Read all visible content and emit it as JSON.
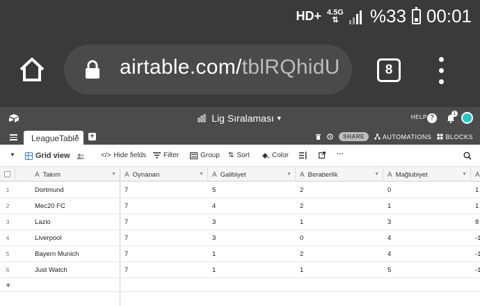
{
  "statusbar": {
    "network": "HD+",
    "network_gen": "4.5G",
    "battery": "%33",
    "time": "00:01"
  },
  "browser": {
    "url_main": "airtable.com/",
    "url_dim": "tblRQhidU",
    "tab_count": "8"
  },
  "app": {
    "base_title": "Lig Sıralaması",
    "help_label": "HELP",
    "notification_count": "1"
  },
  "tabs": {
    "active_table": "LeagueTable",
    "share_label": "SHARE",
    "automations_label": "AUTOMATIONS",
    "blocks_label": "BLOCKS"
  },
  "viewbar": {
    "view_name": "Grid view",
    "hide_fields": "Hide fields",
    "filter": "Filter",
    "group": "Group",
    "sort": "Sort",
    "color": "Color",
    "more": "···"
  },
  "grid": {
    "columns": [
      "Takım",
      "Oynanan",
      "Galibiyet",
      "Beraberlik",
      "Mağlubiyet"
    ],
    "rows": [
      {
        "n": "1",
        "takim": "Dortmund",
        "oynanan": "7",
        "galibiyet": "5",
        "beraberlik": "2",
        "maglubiyet": "0",
        "extra": "1"
      },
      {
        "n": "2",
        "takim": "Mec20 FC",
        "oynanan": "7",
        "galibiyet": "4",
        "beraberlik": "2",
        "maglubiyet": "1",
        "extra": "1"
      },
      {
        "n": "3",
        "takim": "Lazio",
        "oynanan": "7",
        "galibiyet": "3",
        "beraberlik": "1",
        "maglubiyet": "3",
        "extra": "8"
      },
      {
        "n": "4",
        "takim": "Liverpool",
        "oynanan": "7",
        "galibiyet": "3",
        "beraberlik": "0",
        "maglubiyet": "4",
        "extra": "-1"
      },
      {
        "n": "5",
        "takim": "Bayern Munich",
        "oynanan": "7",
        "galibiyet": "1",
        "beraberlik": "2",
        "maglubiyet": "4",
        "extra": "-1"
      },
      {
        "n": "6",
        "takim": "Just Watch",
        "oynanan": "7",
        "galibiyet": "1",
        "beraberlik": "1",
        "maglubiyet": "5",
        "extra": "-1"
      }
    ],
    "add_row": "+"
  }
}
